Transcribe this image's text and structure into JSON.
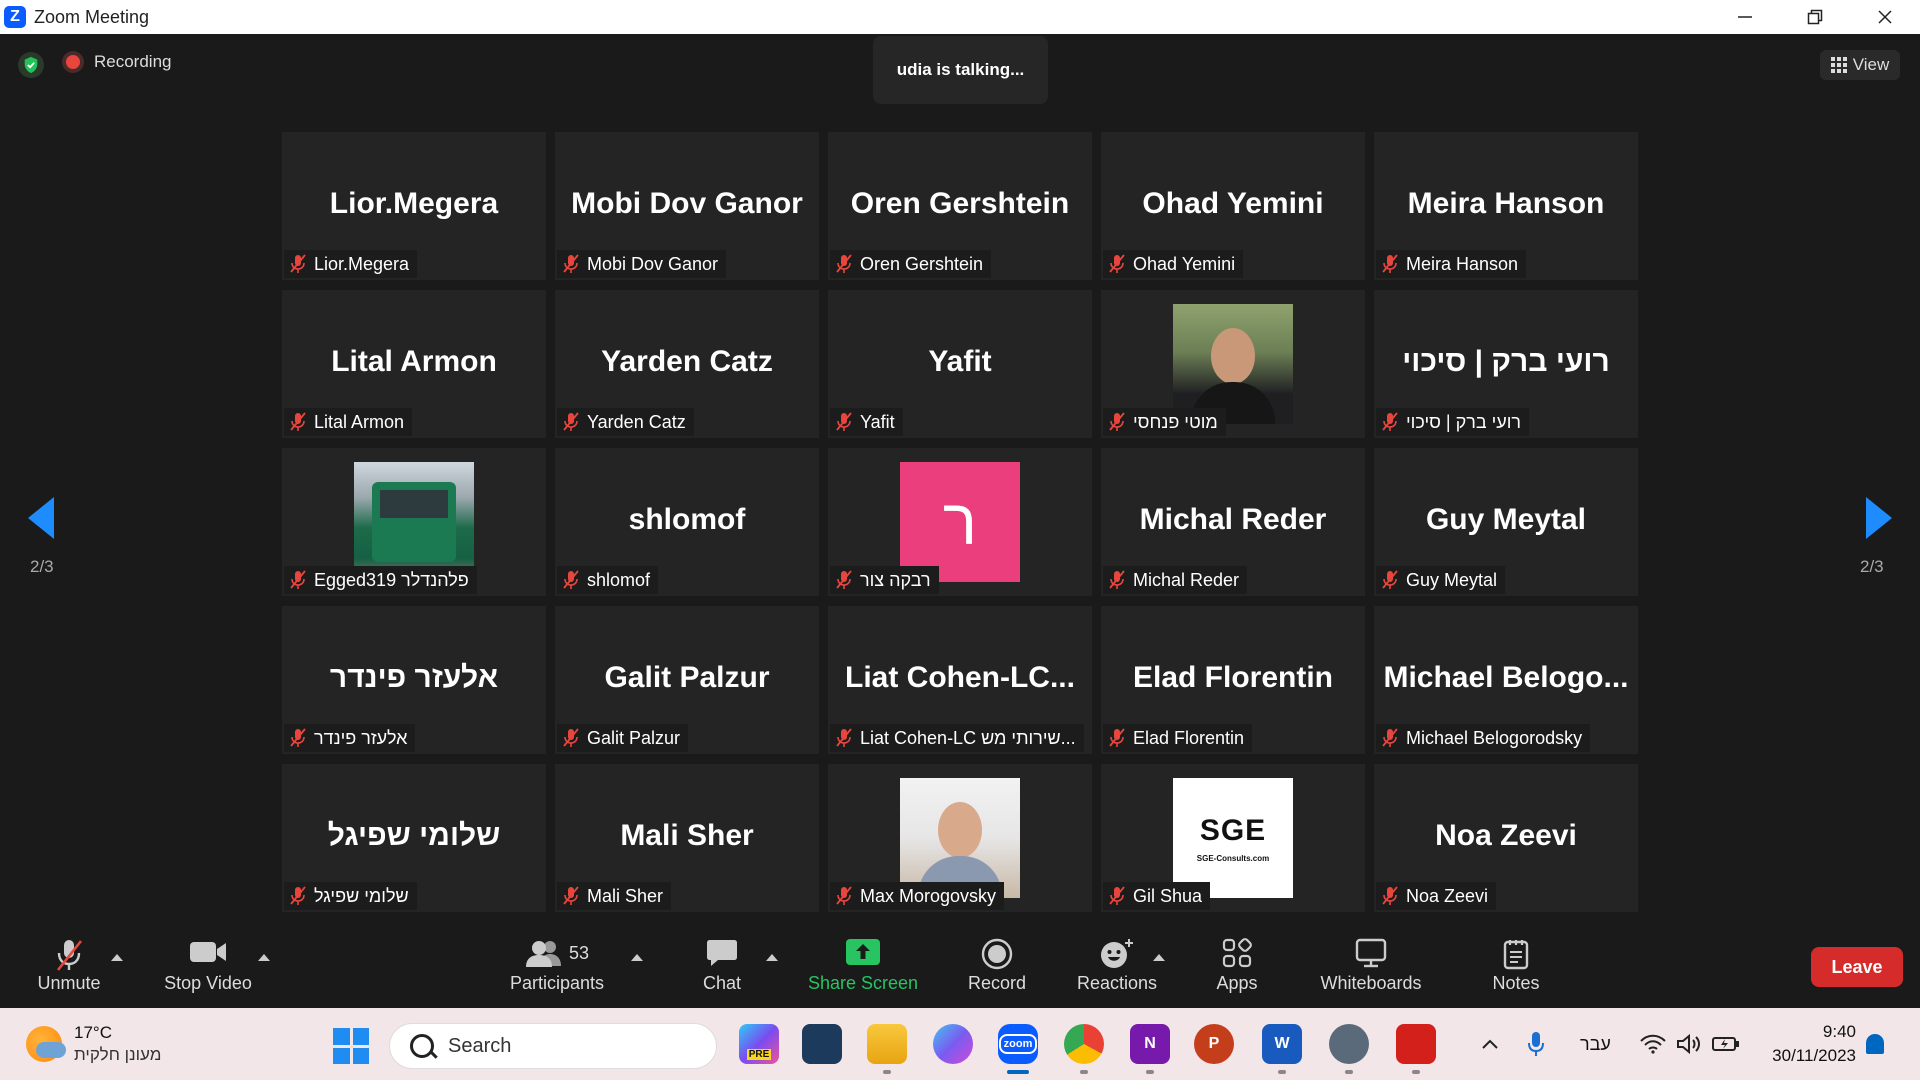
{
  "window": {
    "title": "Zoom Meeting",
    "logo_letter": "Z"
  },
  "status": {
    "recording_label": "Recording",
    "talking_text": "udia is talking...",
    "view_label": "View"
  },
  "pagination": {
    "left": "2/3",
    "right": "2/3"
  },
  "tiles": [
    {
      "name": "Lior.Megera",
      "label": "Lior.Megera"
    },
    {
      "name": "Mobi Dov Ganor",
      "label": "Mobi Dov Ganor"
    },
    {
      "name": "Oren Gershtein",
      "label": "Oren Gershtein"
    },
    {
      "name": "Ohad Yemini",
      "label": "Ohad Yemini"
    },
    {
      "name": "Meira Hanson",
      "label": "Meira Hanson"
    },
    {
      "name": "Lital Armon",
      "label": "Lital Armon"
    },
    {
      "name": "Yarden Catz",
      "label": "Yarden Catz"
    },
    {
      "name": "Yafit",
      "label": "Yafit"
    },
    {
      "name": "",
      "label": "מוטי פנחסי"
    },
    {
      "name": "רועי ברק | סיכוי",
      "label": "רועי ברק | סיכוי"
    },
    {
      "name": "",
      "label": "Egged319 פלהנדלר"
    },
    {
      "name": "shlomof",
      "label": "shlomof"
    },
    {
      "name": "",
      "label": "רבקה צור",
      "avatar_letter": "ר"
    },
    {
      "name": "Michal Reder",
      "label": "Michal Reder"
    },
    {
      "name": "Guy Meytal",
      "label": "Guy Meytal"
    },
    {
      "name": "אלעזר פינדר",
      "label": "אלעזר פינדר"
    },
    {
      "name": "Galit Palzur",
      "label": "Galit Palzur"
    },
    {
      "name": "Liat  Cohen-LC...",
      "label": "Liat Cohen-LC שירותי מש..."
    },
    {
      "name": "Elad Florentin",
      "label": "Elad Florentin"
    },
    {
      "name": "Michael  Belogo...",
      "label": "Michael Belogorodsky"
    },
    {
      "name": "שלומי שפיגל",
      "label": "שלומי שפיגל"
    },
    {
      "name": "Mali Sher",
      "label": "Mali Sher"
    },
    {
      "name": "",
      "label": "Max Morogovsky"
    },
    {
      "name": "",
      "label": "Gil Shua",
      "logo_big": "SGE",
      "logo_small": "SGE-Consults.com"
    },
    {
      "name": "Noa Zeevi",
      "label": "Noa Zeevi"
    }
  ],
  "toolbar": {
    "unmute": "Unmute",
    "stop_video": "Stop Video",
    "participants": "Participants",
    "participants_count": "53",
    "chat": "Chat",
    "share_screen": "Share Screen",
    "record": "Record",
    "reactions": "Reactions",
    "apps": "Apps",
    "whiteboards": "Whiteboards",
    "notes": "Notes",
    "leave": "Leave"
  },
  "taskbar": {
    "temperature": "17°C",
    "weather_desc": "מעונן חלקית",
    "search_placeholder": "Search",
    "language": "עבר",
    "time": "9:40",
    "date": "30/11/2023",
    "copilot_badge": "PRE"
  },
  "colors": {
    "accent_blue": "#1e8cff",
    "leave_red": "#d52b2b",
    "share_green": "#27c461",
    "mic_off_red": "#e8463d",
    "avatar_pink": "#ea3f7c"
  }
}
